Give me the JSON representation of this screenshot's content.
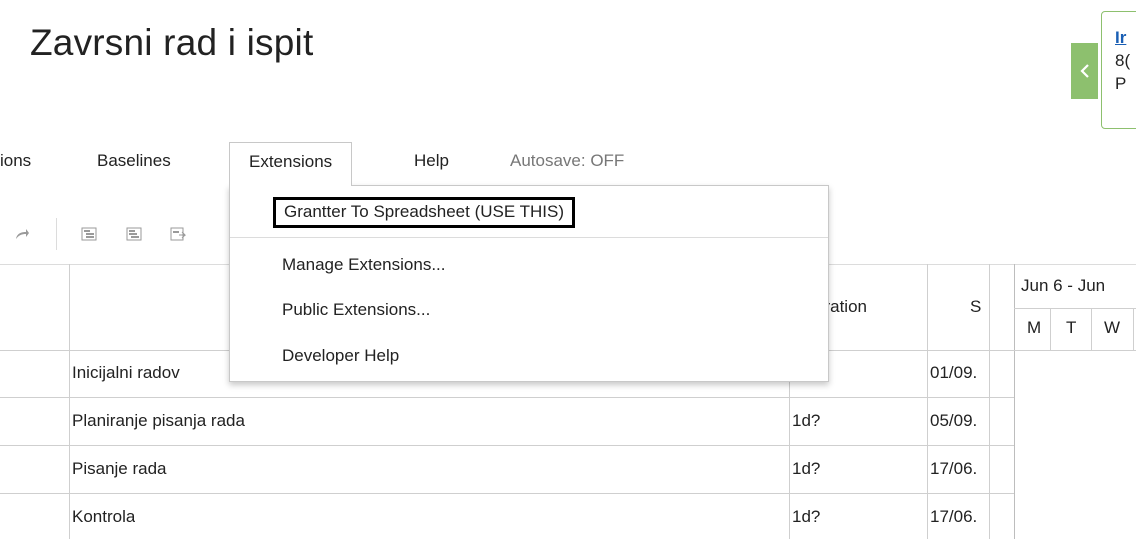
{
  "page": {
    "title": "Zavrsni rad i ispit"
  },
  "notification": {
    "link_text": "Ir",
    "line2": "8(",
    "line3": "P",
    "toggle_icon": "chevron-left-icon",
    "accent_color": "#8dc06e"
  },
  "menubar": {
    "items": [
      {
        "label": "ions"
      },
      {
        "label": "Baselines"
      },
      {
        "label": "Extensions"
      },
      {
        "label": "Help"
      }
    ],
    "autosave": "Autosave: OFF"
  },
  "toolbar": {
    "icons": [
      "redo-icon",
      "indent-icon",
      "outdent-icon",
      "link-task-icon"
    ]
  },
  "extensions_menu": {
    "items": [
      {
        "label": "Grantter To Spreadsheet (USE THIS)"
      },
      {
        "label": "Manage Extensions..."
      },
      {
        "label": "Public Extensions..."
      },
      {
        "label": "Developer Help"
      }
    ]
  },
  "grid": {
    "headers": {
      "duration": "uration",
      "start": "S"
    },
    "gantt_header": {
      "week": "Jun 6 - Jun",
      "days": [
        "M",
        "T",
        "W"
      ]
    },
    "rows": [
      {
        "name": "Inicijalni radov",
        "duration": "",
        "start": "01/09."
      },
      {
        "name": "Planiranje pisanja rada",
        "duration": "1d?",
        "start": "05/09."
      },
      {
        "name": "Pisanje rada",
        "duration": "1d?",
        "start": "17/06."
      },
      {
        "name": "Kontrola",
        "duration": "1d?",
        "start": "17/06."
      }
    ]
  }
}
